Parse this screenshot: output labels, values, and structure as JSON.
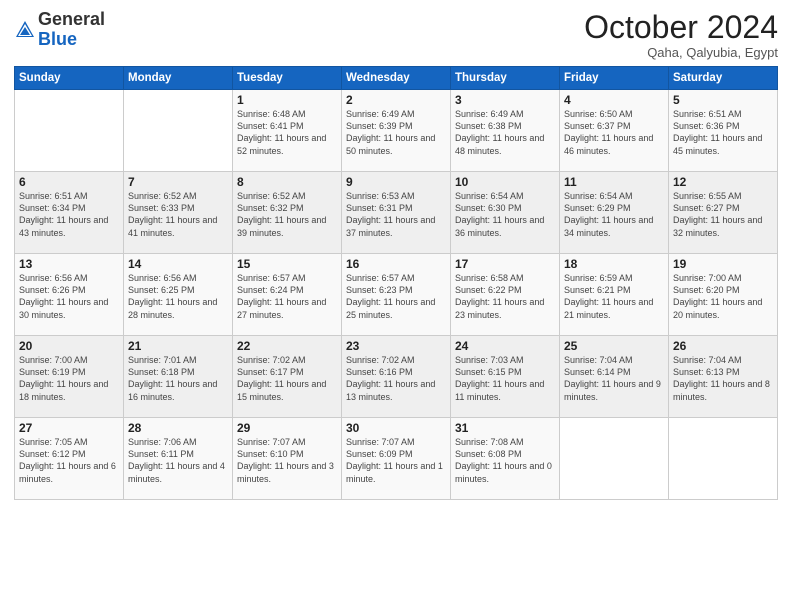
{
  "header": {
    "logo_line1": "General",
    "logo_line2": "Blue",
    "month": "October 2024",
    "location": "Qaha, Qalyubia, Egypt"
  },
  "weekdays": [
    "Sunday",
    "Monday",
    "Tuesday",
    "Wednesday",
    "Thursday",
    "Friday",
    "Saturday"
  ],
  "weeks": [
    [
      {
        "day": "",
        "info": ""
      },
      {
        "day": "",
        "info": ""
      },
      {
        "day": "1",
        "info": "Sunrise: 6:48 AM\nSunset: 6:41 PM\nDaylight: 11 hours and 52 minutes."
      },
      {
        "day": "2",
        "info": "Sunrise: 6:49 AM\nSunset: 6:39 PM\nDaylight: 11 hours and 50 minutes."
      },
      {
        "day": "3",
        "info": "Sunrise: 6:49 AM\nSunset: 6:38 PM\nDaylight: 11 hours and 48 minutes."
      },
      {
        "day": "4",
        "info": "Sunrise: 6:50 AM\nSunset: 6:37 PM\nDaylight: 11 hours and 46 minutes."
      },
      {
        "day": "5",
        "info": "Sunrise: 6:51 AM\nSunset: 6:36 PM\nDaylight: 11 hours and 45 minutes."
      }
    ],
    [
      {
        "day": "6",
        "info": "Sunrise: 6:51 AM\nSunset: 6:34 PM\nDaylight: 11 hours and 43 minutes."
      },
      {
        "day": "7",
        "info": "Sunrise: 6:52 AM\nSunset: 6:33 PM\nDaylight: 11 hours and 41 minutes."
      },
      {
        "day": "8",
        "info": "Sunrise: 6:52 AM\nSunset: 6:32 PM\nDaylight: 11 hours and 39 minutes."
      },
      {
        "day": "9",
        "info": "Sunrise: 6:53 AM\nSunset: 6:31 PM\nDaylight: 11 hours and 37 minutes."
      },
      {
        "day": "10",
        "info": "Sunrise: 6:54 AM\nSunset: 6:30 PM\nDaylight: 11 hours and 36 minutes."
      },
      {
        "day": "11",
        "info": "Sunrise: 6:54 AM\nSunset: 6:29 PM\nDaylight: 11 hours and 34 minutes."
      },
      {
        "day": "12",
        "info": "Sunrise: 6:55 AM\nSunset: 6:27 PM\nDaylight: 11 hours and 32 minutes."
      }
    ],
    [
      {
        "day": "13",
        "info": "Sunrise: 6:56 AM\nSunset: 6:26 PM\nDaylight: 11 hours and 30 minutes."
      },
      {
        "day": "14",
        "info": "Sunrise: 6:56 AM\nSunset: 6:25 PM\nDaylight: 11 hours and 28 minutes."
      },
      {
        "day": "15",
        "info": "Sunrise: 6:57 AM\nSunset: 6:24 PM\nDaylight: 11 hours and 27 minutes."
      },
      {
        "day": "16",
        "info": "Sunrise: 6:57 AM\nSunset: 6:23 PM\nDaylight: 11 hours and 25 minutes."
      },
      {
        "day": "17",
        "info": "Sunrise: 6:58 AM\nSunset: 6:22 PM\nDaylight: 11 hours and 23 minutes."
      },
      {
        "day": "18",
        "info": "Sunrise: 6:59 AM\nSunset: 6:21 PM\nDaylight: 11 hours and 21 minutes."
      },
      {
        "day": "19",
        "info": "Sunrise: 7:00 AM\nSunset: 6:20 PM\nDaylight: 11 hours and 20 minutes."
      }
    ],
    [
      {
        "day": "20",
        "info": "Sunrise: 7:00 AM\nSunset: 6:19 PM\nDaylight: 11 hours and 18 minutes."
      },
      {
        "day": "21",
        "info": "Sunrise: 7:01 AM\nSunset: 6:18 PM\nDaylight: 11 hours and 16 minutes."
      },
      {
        "day": "22",
        "info": "Sunrise: 7:02 AM\nSunset: 6:17 PM\nDaylight: 11 hours and 15 minutes."
      },
      {
        "day": "23",
        "info": "Sunrise: 7:02 AM\nSunset: 6:16 PM\nDaylight: 11 hours and 13 minutes."
      },
      {
        "day": "24",
        "info": "Sunrise: 7:03 AM\nSunset: 6:15 PM\nDaylight: 11 hours and 11 minutes."
      },
      {
        "day": "25",
        "info": "Sunrise: 7:04 AM\nSunset: 6:14 PM\nDaylight: 11 hours and 9 minutes."
      },
      {
        "day": "26",
        "info": "Sunrise: 7:04 AM\nSunset: 6:13 PM\nDaylight: 11 hours and 8 minutes."
      }
    ],
    [
      {
        "day": "27",
        "info": "Sunrise: 7:05 AM\nSunset: 6:12 PM\nDaylight: 11 hours and 6 minutes."
      },
      {
        "day": "28",
        "info": "Sunrise: 7:06 AM\nSunset: 6:11 PM\nDaylight: 11 hours and 4 minutes."
      },
      {
        "day": "29",
        "info": "Sunrise: 7:07 AM\nSunset: 6:10 PM\nDaylight: 11 hours and 3 minutes."
      },
      {
        "day": "30",
        "info": "Sunrise: 7:07 AM\nSunset: 6:09 PM\nDaylight: 11 hours and 1 minute."
      },
      {
        "day": "31",
        "info": "Sunrise: 7:08 AM\nSunset: 6:08 PM\nDaylight: 11 hours and 0 minutes."
      },
      {
        "day": "",
        "info": ""
      },
      {
        "day": "",
        "info": ""
      }
    ]
  ]
}
